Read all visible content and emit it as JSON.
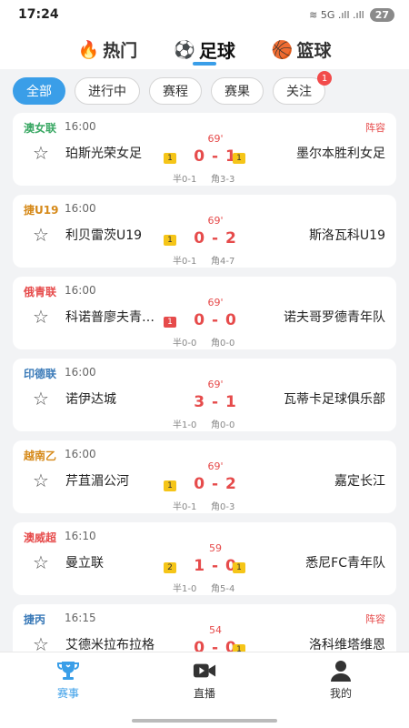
{
  "status": {
    "time": "17:24",
    "signal": "≋ 5G .ıll .ıll",
    "battery": "27"
  },
  "sport_tabs": [
    {
      "label": "热门",
      "emoji": "🔥"
    },
    {
      "label": "足球",
      "emoji": "⚽"
    },
    {
      "label": "篮球",
      "emoji": "🏀"
    }
  ],
  "filters": [
    {
      "label": "全部"
    },
    {
      "label": "进行中"
    },
    {
      "label": "赛程"
    },
    {
      "label": "赛果"
    },
    {
      "label": "关注",
      "badge": "1"
    }
  ],
  "matches": [
    {
      "league": "澳女联",
      "league_color": "#3aa864",
      "time": "16:00",
      "lineup": "阵容",
      "home": "珀斯光荣女足",
      "away": "墨尔本胜利女足",
      "minute": "69'",
      "score": "0 - 1",
      "home_tag": "1",
      "home_tag_color": "yellow",
      "away_tag": "1",
      "away_tag_color": "yellow",
      "half": "半0-1",
      "corner": "角3-3"
    },
    {
      "league": "捷U19",
      "league_color": "#d68a1a",
      "time": "16:00",
      "lineup": "",
      "home": "利贝雷茨U19",
      "away": "斯洛瓦科U19",
      "minute": "69'",
      "score": "0 - 2",
      "home_tag": "1",
      "home_tag_color": "yellow",
      "away_tag": "",
      "away_tag_color": "",
      "half": "半0-1",
      "corner": "角4-7"
    },
    {
      "league": "俄青联",
      "league_color": "#e64b4b",
      "time": "16:00",
      "lineup": "",
      "home": "科诺普廖夫青…",
      "away": "诺夫哥罗德青年队",
      "minute": "69'",
      "score": "0 - 0",
      "home_tag": "1",
      "home_tag_color": "red",
      "away_tag": "",
      "away_tag_color": "",
      "half": "半0-0",
      "corner": "角0-0"
    },
    {
      "league": "印德联",
      "league_color": "#3a7ab8",
      "time": "16:00",
      "lineup": "",
      "home": "诺伊达城",
      "away": "瓦蒂卡足球俱乐部",
      "minute": "69'",
      "score": "3 - 1",
      "home_tag": "",
      "home_tag_color": "",
      "away_tag": "",
      "away_tag_color": "",
      "half": "半1-0",
      "corner": "角0-0"
    },
    {
      "league": "越南乙",
      "league_color": "#d68a1a",
      "time": "16:00",
      "lineup": "",
      "home": "芹苴湄公河",
      "away": "嘉定长江",
      "minute": "69'",
      "score": "0 - 2",
      "home_tag": "1",
      "home_tag_color": "yellow",
      "away_tag": "",
      "away_tag_color": "",
      "half": "半0-1",
      "corner": "角0-3"
    },
    {
      "league": "澳威超",
      "league_color": "#e64b4b",
      "time": "16:10",
      "lineup": "",
      "home": "曼立联",
      "away": "悉尼FC青年队",
      "minute": "59",
      "score": "1 - 0",
      "home_tag": "2",
      "home_tag_color": "yellow",
      "away_tag": "1",
      "away_tag_color": "yellow",
      "half": "半1-0",
      "corner": "角5-4"
    },
    {
      "league": "捷丙",
      "league_color": "#3a7ab8",
      "time": "16:15",
      "lineup": "阵容",
      "home": "艾德米拉布拉格",
      "away": "洛科维塔维恩",
      "minute": "54",
      "score": "0 - 0",
      "home_tag": "",
      "home_tag_color": "",
      "away_tag": "1",
      "away_tag_color": "yellow",
      "half": "",
      "corner": ""
    }
  ],
  "bottom_nav": [
    {
      "label": "赛事",
      "icon": "trophy-icon"
    },
    {
      "label": "直播",
      "icon": "video-camera-icon"
    },
    {
      "label": "我的",
      "icon": "person-icon"
    }
  ],
  "colors": {
    "accent": "#3a9ee8",
    "live": "#e64b4b"
  }
}
